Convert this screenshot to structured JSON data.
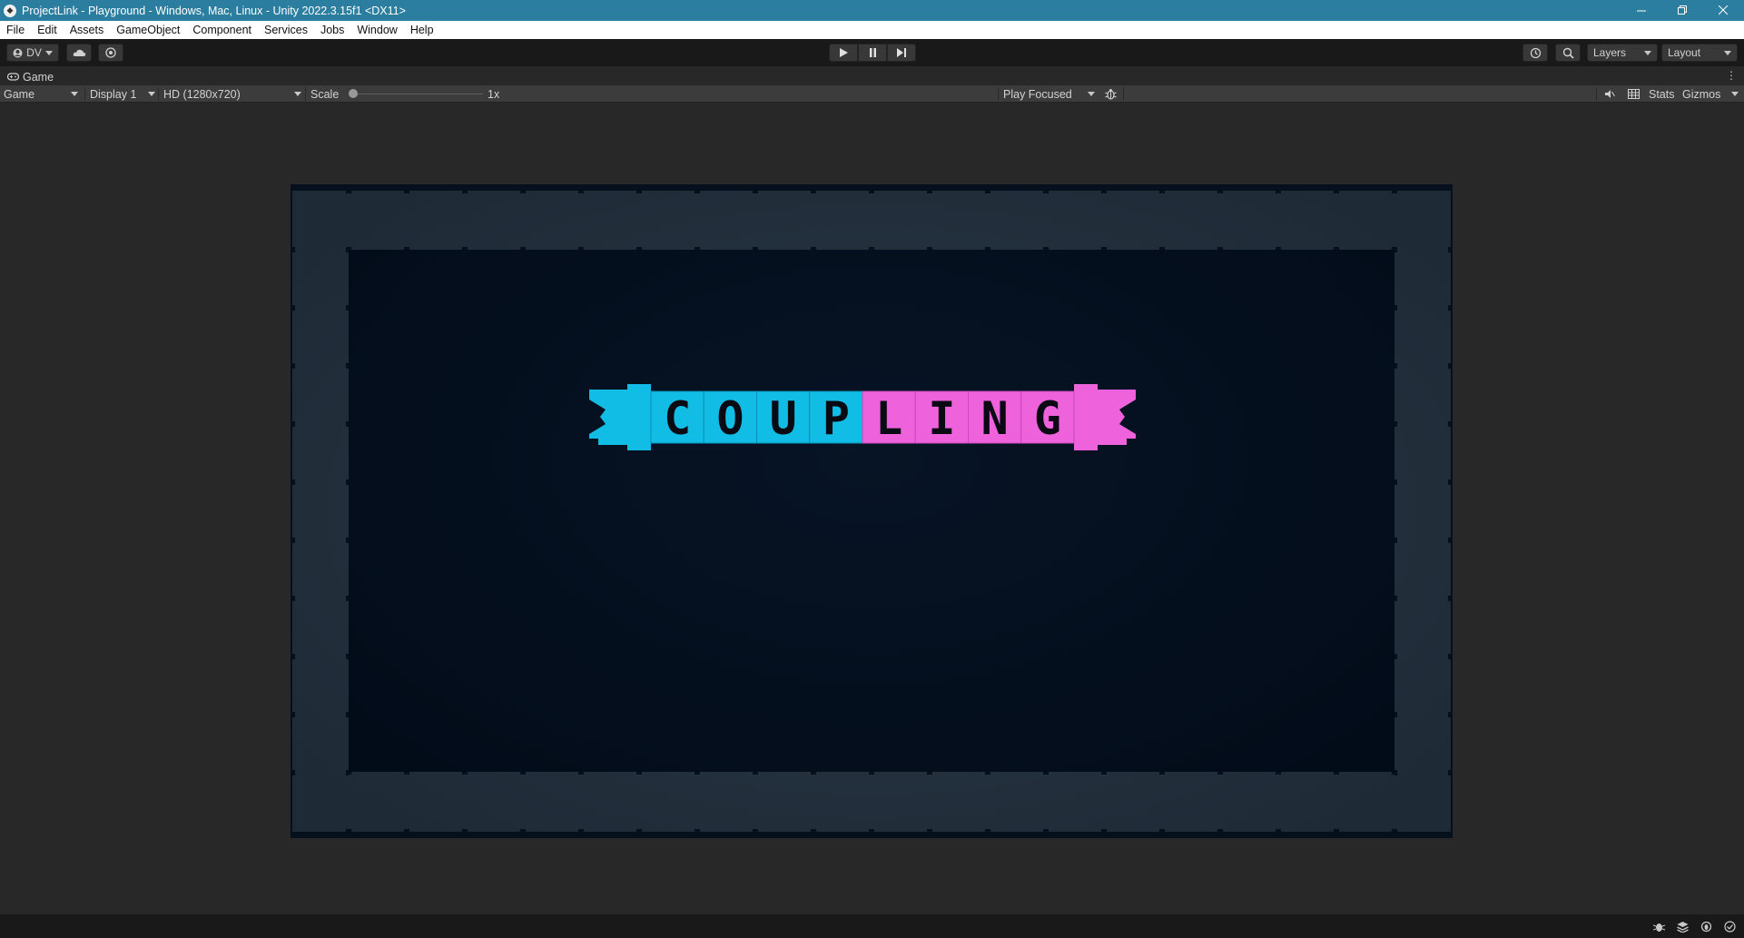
{
  "window": {
    "title": "ProjectLink - Playground - Windows, Mac, Linux - Unity 2022.3.15f1 <DX11>"
  },
  "menu": {
    "items": [
      "File",
      "Edit",
      "Assets",
      "GameObject",
      "Component",
      "Services",
      "Jobs",
      "Window",
      "Help"
    ]
  },
  "toolbar": {
    "account_label": "DV",
    "layers_label": "Layers",
    "layout_label": "Layout"
  },
  "tab": {
    "label": "Game"
  },
  "gamebar": {
    "view_select": "Game",
    "display_select": "Display 1",
    "resolution_select": "HD (1280x720)",
    "scale_label": "Scale",
    "scale_value": "1x",
    "scale_level": 0.0,
    "play_mode": "Play Focused",
    "stats_label": "Stats",
    "gizmos_label": "Gizmos"
  },
  "game": {
    "logo_letters": [
      "C",
      "O",
      "U",
      "P",
      "L",
      "I",
      "N",
      "G"
    ],
    "colors": {
      "cyan": "#12bde5",
      "pink": "#ee62dc",
      "background": "#020b18",
      "border": "#253443"
    }
  }
}
